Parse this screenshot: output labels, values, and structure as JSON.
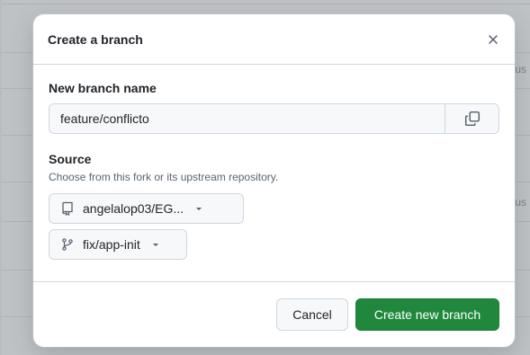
{
  "background": {
    "status_text": "tus"
  },
  "modal": {
    "title": "Create a branch",
    "close_label": "×",
    "branch_name": {
      "label": "New branch name",
      "value": "feature/conflicto"
    },
    "source": {
      "title": "Source",
      "description": "Choose from this fork or its upstream repository.",
      "repository": "angelalop03/EG...",
      "branch": "fix/app-init"
    },
    "footer": {
      "cancel_label": "Cancel",
      "create_label": "Create new branch"
    }
  },
  "colors": {
    "primary": "#1f883d",
    "border": "#d0d7de",
    "input_bg": "#f6f8fa"
  },
  "icons": {
    "close": "close-icon",
    "copy": "copy-icon",
    "repo": "repo-icon",
    "branch": "git-branch-icon",
    "caret": "caret-down-icon"
  }
}
